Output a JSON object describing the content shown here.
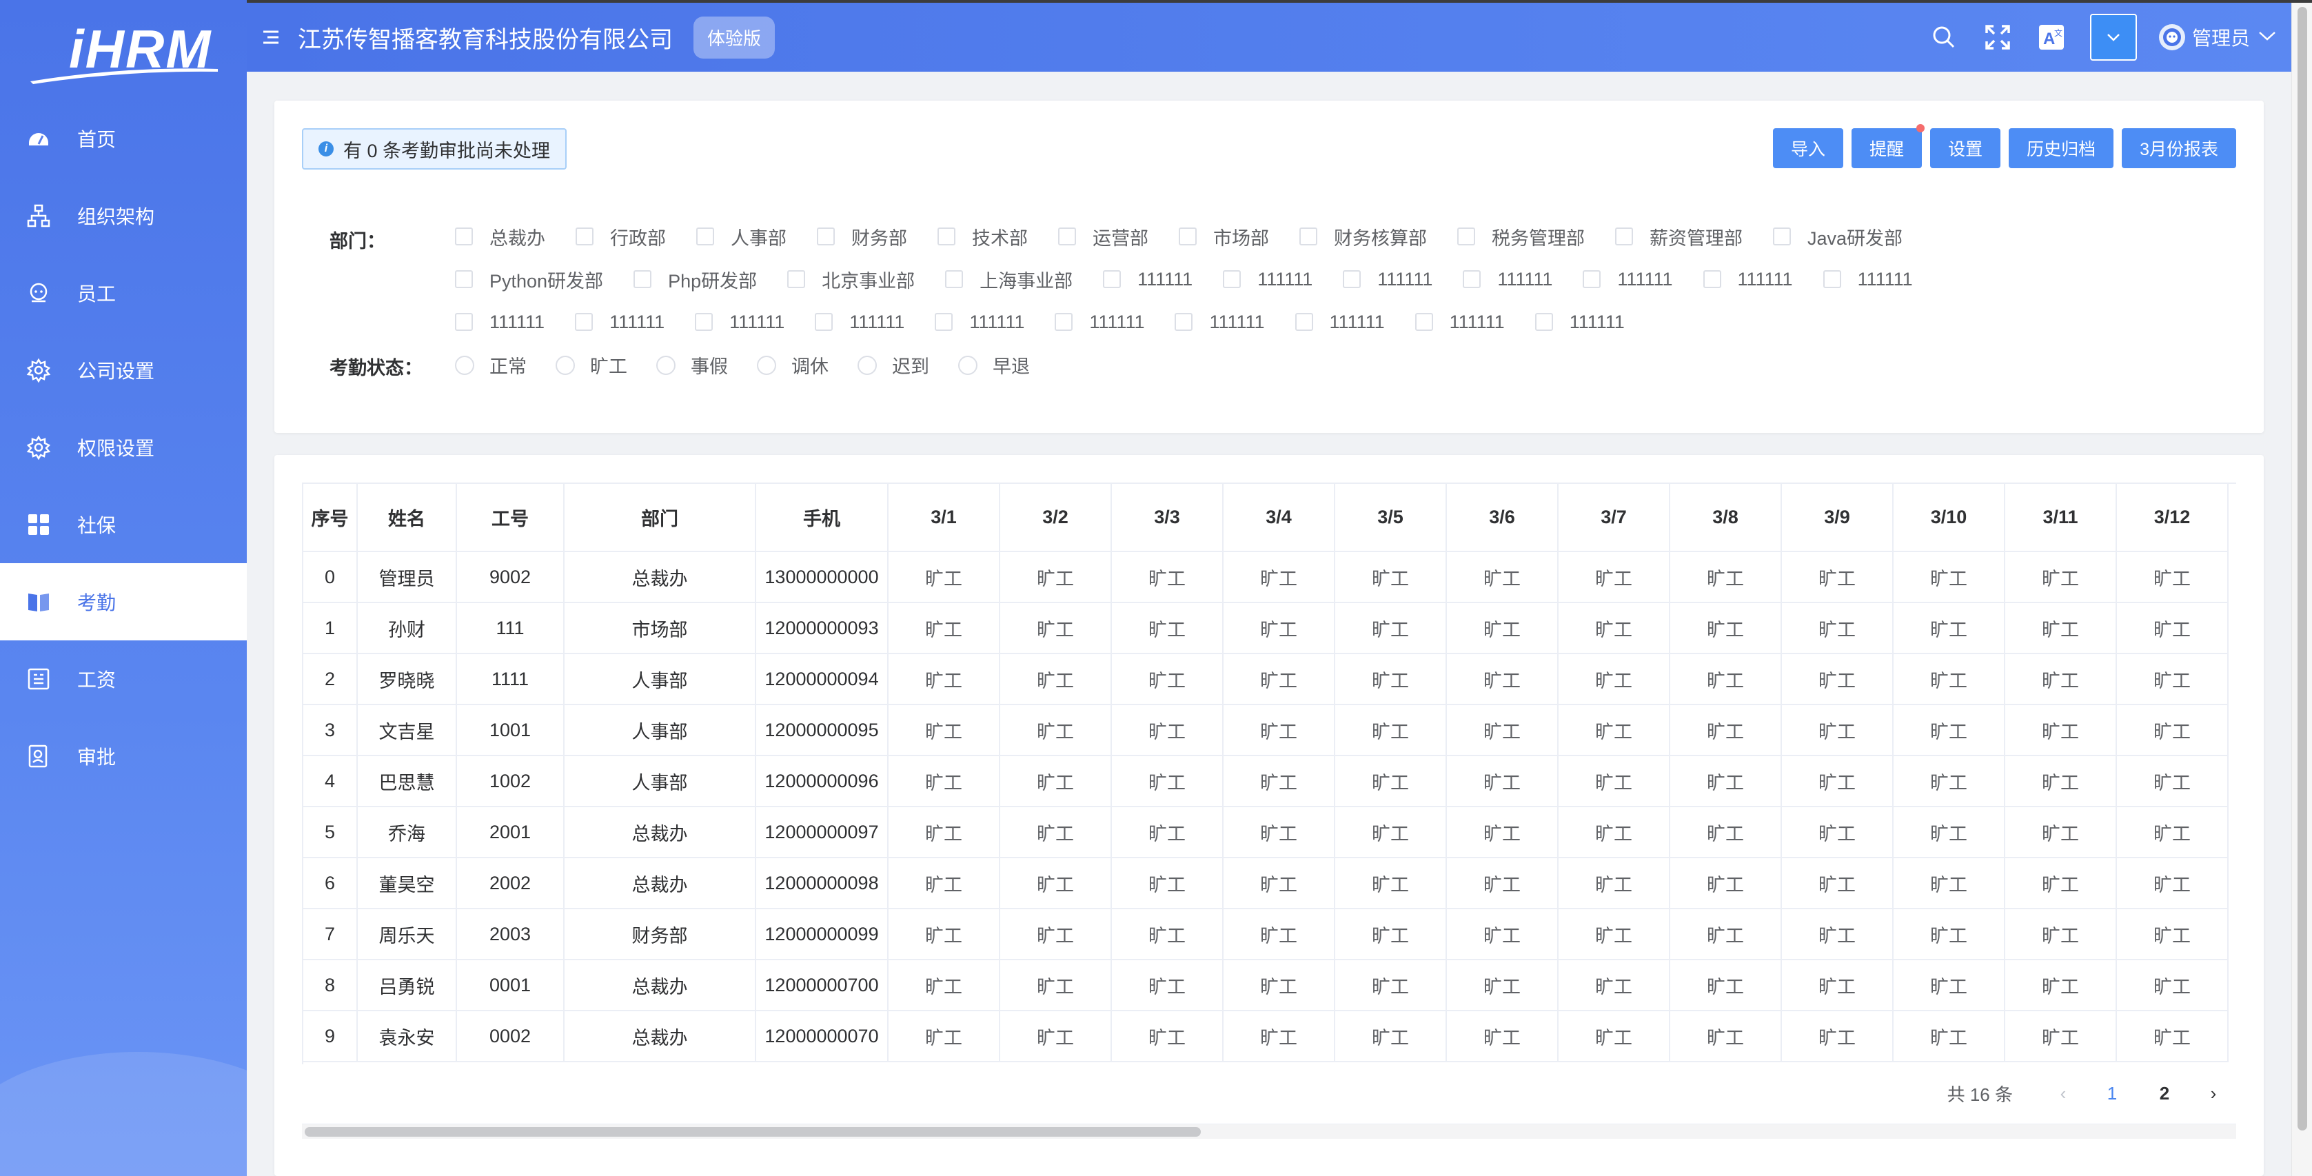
{
  "app": {
    "logo_text": "iHRM",
    "company": "江苏传智播客教育科技股份有限公司",
    "trial_badge": "体验版",
    "user_name": "管理员",
    "accent": "#4a74e8"
  },
  "sidebar": {
    "items": [
      {
        "label": "首页",
        "icon": "dashboard-icon"
      },
      {
        "label": "组织架构",
        "icon": "org-tree-icon"
      },
      {
        "label": "员工",
        "icon": "employee-icon"
      },
      {
        "label": "公司设置",
        "icon": "gear-icon"
      },
      {
        "label": "权限设置",
        "icon": "gear-icon"
      },
      {
        "label": "社保",
        "icon": "grid-icon"
      },
      {
        "label": "考勤",
        "icon": "book-icon",
        "active": true
      },
      {
        "label": "工资",
        "icon": "salary-icon"
      },
      {
        "label": "审批",
        "icon": "approval-icon"
      }
    ]
  },
  "header_icons": [
    "search-icon",
    "fullscreen-icon",
    "translate-icon",
    "dropdown-icon"
  ],
  "notice": "有 0 条考勤审批尚未处理",
  "buttons": {
    "import": "导入",
    "remind": "提醒",
    "settings": "设置",
    "history": "历史归档",
    "report": "3月份报表"
  },
  "filter": {
    "dept_label": "部门：",
    "status_label": "考勤状态：",
    "departments": [
      [
        "总裁办",
        "行政部",
        "人事部",
        "财务部",
        "技术部",
        "运营部",
        "市场部",
        "财务核算部",
        "税务管理部",
        "薪资管理部",
        "Java研发部"
      ],
      [
        "Python研发部",
        "Php研发部",
        "北京事业部",
        "上海事业部",
        "111111",
        "111111",
        "111111",
        "111111",
        "111111",
        "111111",
        "111111"
      ],
      [
        "111111",
        "111111",
        "111111",
        "111111",
        "111111",
        "111111",
        "111111",
        "111111",
        "111111",
        "111111"
      ]
    ],
    "statuses": [
      "正常",
      "旷工",
      "事假",
      "调休",
      "迟到",
      "早退"
    ]
  },
  "table": {
    "headers": [
      "序号",
      "姓名",
      "工号",
      "部门",
      "手机",
      "3/1",
      "3/2",
      "3/3",
      "3/4",
      "3/5",
      "3/6",
      "3/7",
      "3/8",
      "3/9",
      "3/10",
      "3/11",
      "3/12"
    ],
    "rows": [
      {
        "idx": "0",
        "name": "管理员",
        "id": "9002",
        "dept": "总裁办",
        "phone": "13000000000"
      },
      {
        "idx": "1",
        "name": "孙财",
        "id": "111",
        "dept": "市场部",
        "phone": "12000000093"
      },
      {
        "idx": "2",
        "name": "罗晓晓",
        "id": "1111",
        "dept": "人事部",
        "phone": "12000000094"
      },
      {
        "idx": "3",
        "name": "文吉星",
        "id": "1001",
        "dept": "人事部",
        "phone": "12000000095"
      },
      {
        "idx": "4",
        "name": "巴思慧",
        "id": "1002",
        "dept": "人事部",
        "phone": "12000000096"
      },
      {
        "idx": "5",
        "name": "乔海",
        "id": "2001",
        "dept": "总裁办",
        "phone": "12000000097"
      },
      {
        "idx": "6",
        "name": "董昊空",
        "id": "2002",
        "dept": "总裁办",
        "phone": "12000000098"
      },
      {
        "idx": "7",
        "name": "周乐天",
        "id": "2003",
        "dept": "财务部",
        "phone": "12000000099"
      },
      {
        "idx": "8",
        "name": "吕勇锐",
        "id": "0001",
        "dept": "总裁办",
        "phone": "12000000700"
      },
      {
        "idx": "9",
        "name": "袁永安",
        "id": "0002",
        "dept": "总裁办",
        "phone": "12000000070"
      }
    ],
    "day_status": "旷工"
  },
  "pager": {
    "total": "共 16 条",
    "pages": [
      "1",
      "2"
    ],
    "current": "1"
  }
}
